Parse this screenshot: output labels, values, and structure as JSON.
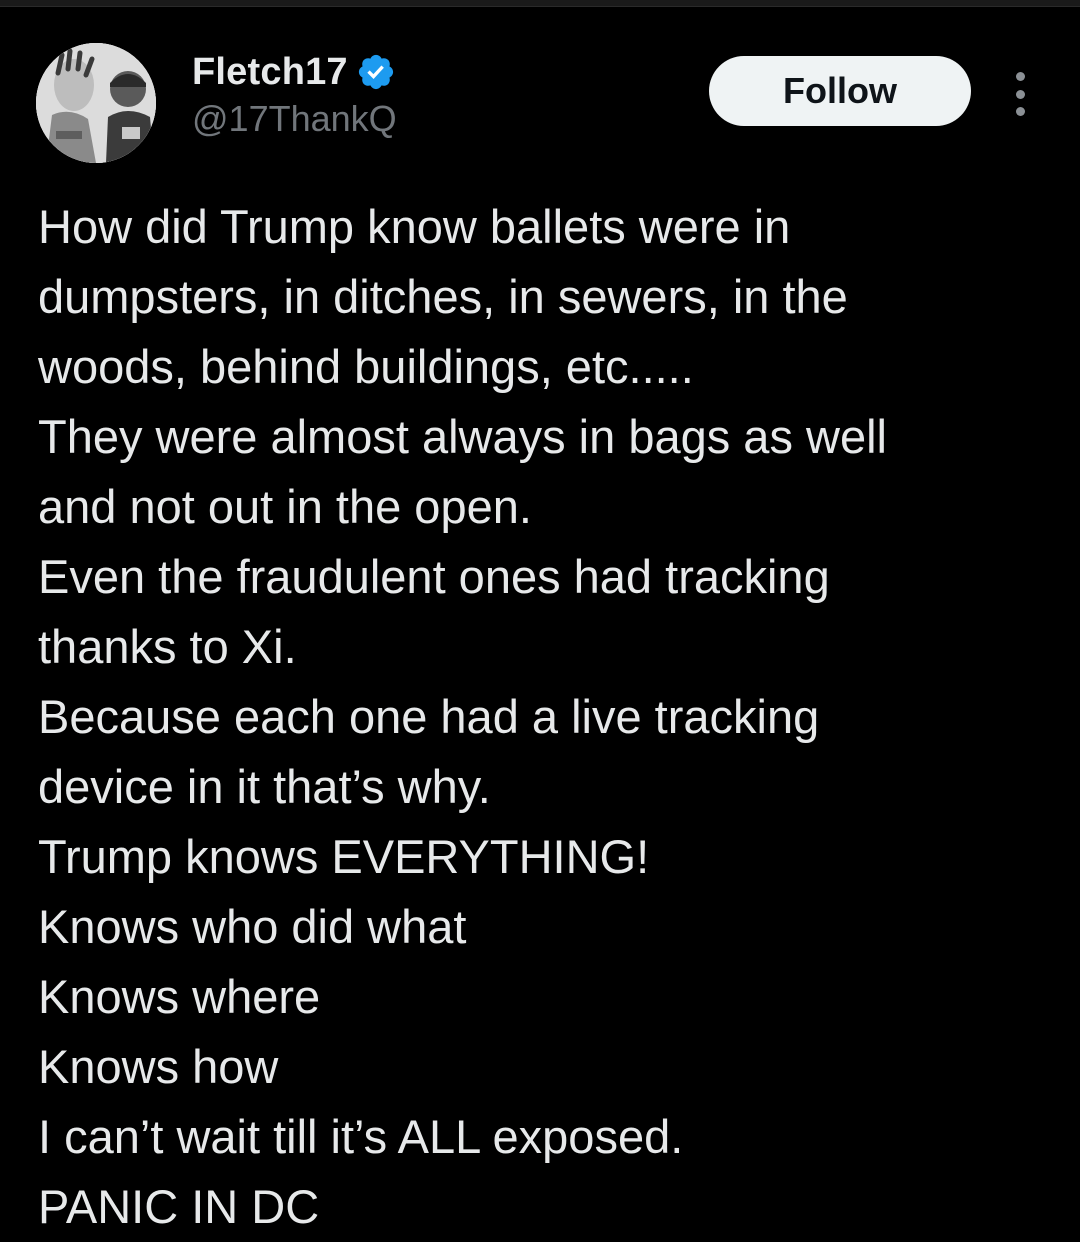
{
  "author": {
    "display_name": "Fletch17",
    "handle": "@17ThankQ",
    "verified": true,
    "verified_color": "#1d9bf0",
    "avatar_icon": "profile-photo"
  },
  "actions": {
    "follow_label": "Follow",
    "more_icon": "more-dots-vertical-icon"
  },
  "tweet": {
    "lines": [
      "How did Trump know ballets were in",
      "dumpsters, in ditches, in sewers, in the",
      "woods, behind buildings, etc.....",
      "They were almost always in bags as well",
      "and not out in the open.",
      "Even the fraudulent ones had tracking",
      "thanks to Xi.",
      "Because each one had a live tracking",
      "device in it that’s why.",
      "Trump knows EVERYTHING!",
      "Knows who did what",
      "Knows where",
      "Knows how",
      "I can’t wait till it’s ALL exposed.",
      "PANIC IN DC"
    ]
  },
  "theme": {
    "background": "#000000",
    "text": "#e7e9ea",
    "muted": "#71767b",
    "button_bg": "#eff3f4",
    "button_text": "#0f1419"
  }
}
